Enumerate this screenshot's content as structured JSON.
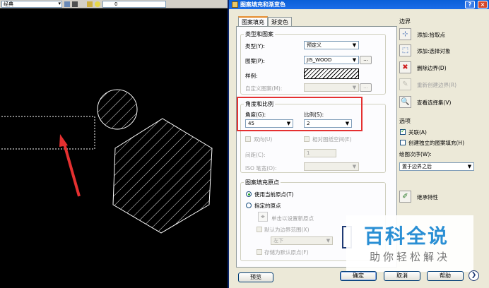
{
  "cad": {
    "style_combo": "经典",
    "layer_combo": "0"
  },
  "dialog": {
    "title": "图案填充和渐变色",
    "help_btn": "?",
    "close_btn": "×"
  },
  "tabs": [
    {
      "label": "图案填充",
      "active": true
    },
    {
      "label": "渐变色",
      "active": false
    }
  ],
  "type_pattern": {
    "group_title": "类型和图案",
    "type_label": "类型(Y):",
    "type_value": "预定义",
    "pattern_label": "图案(P):",
    "pattern_value": "JIS_WOOD",
    "pattern_browse": "...",
    "sample_label": "样例:",
    "custom_label": "自定义图案(M):",
    "custom_browse": "..."
  },
  "angle_scale": {
    "group_title": "角度和比例",
    "angle_label": "角度(G):",
    "angle_value": "45",
    "scale_label": "比例(S):",
    "scale_value": "2",
    "double_label": "双向(U)",
    "relative_label": "相对图纸空间(E)",
    "spacing_label": "间距(C):",
    "spacing_value": "1",
    "iso_label": "ISO 笔宽(O):"
  },
  "origin": {
    "group_title": "图案填充原点",
    "use_current": "使用当前原点(T)",
    "specified": "指定的原点",
    "click_set": "单击以设置新原点",
    "default_boundary": "默认为边界范围(X)",
    "position_value": "左下",
    "store_default": "存储为默认原点(F)"
  },
  "boundary": {
    "title": "边界",
    "add_pick": "添加:拾取点",
    "add_select": "添加:选择对象",
    "remove": "删除边界(D)",
    "recreate": "重新创建边界(R)",
    "view_sel": "查看选择集(V)"
  },
  "options": {
    "title": "选项",
    "associative": "关联(A)",
    "independent": "创建独立的图案填充(H)",
    "draw_order_label": "绘图次序(W):",
    "draw_order_value": "置于边界之后",
    "inherit": "继承特性"
  },
  "footer": {
    "preview": "预览",
    "ok": "确定",
    "cancel": "取消",
    "help": "帮助"
  },
  "watermark": {
    "title": "百科全说",
    "subtitle": "助你轻松解决"
  },
  "colors": {
    "highlight": "#e53030",
    "titlebar": "#0a5fd8",
    "watermark_blue": "#2a8fd4"
  }
}
